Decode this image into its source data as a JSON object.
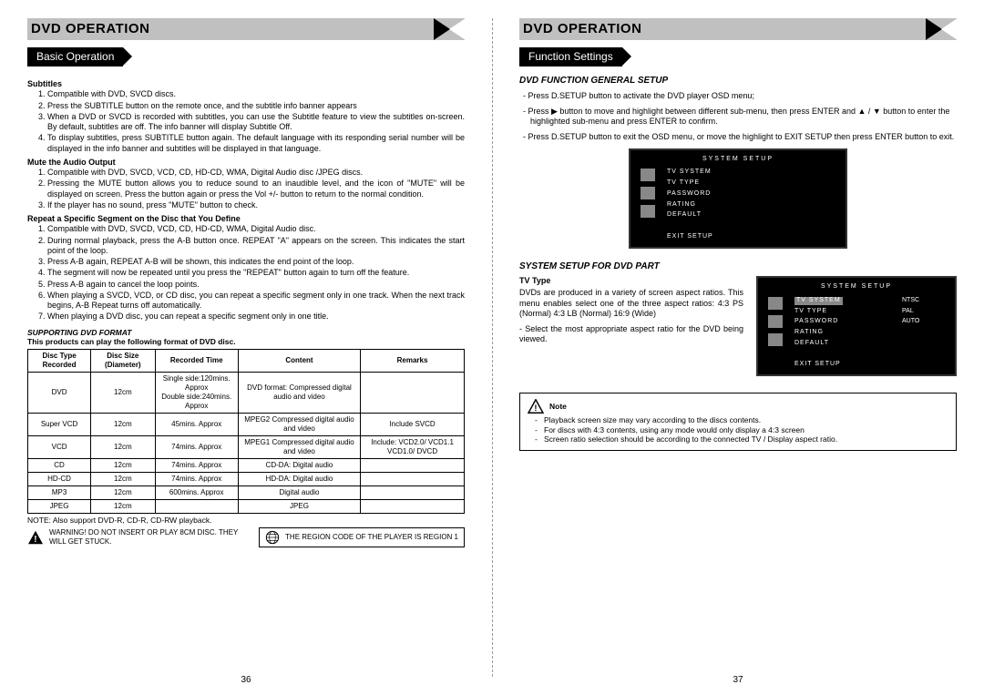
{
  "left": {
    "header": "DVD OPERATION",
    "sub": "Basic Operation",
    "s1": {
      "title": "Subtitles",
      "items": [
        "Compatible with DVD, SVCD discs.",
        "Press the SUBTITLE button on the remote once, and the subtitle info banner appears",
        "When a DVD or SVCD is recorded with subtitles, you can use the Subtitle feature to view the subtitles on-screen. By default, subtitles are off. The info banner will display Subtitle Off.",
        "To display subtitles, press SUBTITLE button again. The default language with its responding serial number will be displayed in the info banner and subtitles will be displayed in that language."
      ]
    },
    "s2": {
      "title": "Mute the Audio Output",
      "items": [
        "Compatible with DVD, SVCD, VCD, CD, HD-CD, WMA, Digital Audio disc /JPEG discs.",
        "Pressing the MUTE button allows you to reduce sound to an inaudible level, and the icon of \"MUTE\" will be displayed on screen. Press the button again or press the Vol +/- button to return to the normal condition.",
        "If the player has no sound, press \"MUTE\" button to check."
      ]
    },
    "s3": {
      "title": "Repeat a Specific Segment on the Disc that You Define",
      "items": [
        "Compatible with DVD, SVCD, VCD, CD, HD-CD, WMA, Digital Audio disc.",
        "During normal playback, press the A-B button once. REPEAT \"A\" appears on the screen. This indicates the start point of the loop.",
        "Press A-B again, REPEAT A-B will be shown, this indicates the end point of the loop.",
        "The segment will now be repeated until you press the \"REPEAT\" button again to turn off the feature.",
        "Press A-B again to cancel the loop points.",
        "When playing a SVCD, VCD, or CD disc, you can repeat a specific segment only in one track. When the next track begins, A-B Repeat turns off automatically.",
        "When playing a DVD disc, you can repeat a specific segment only in one title."
      ]
    },
    "fmt_title": "SUPPORTING DVD FORMAT",
    "fmt_sub": "This products can play the following format of DVD disc.",
    "th": [
      "Disc Type Recorded",
      "Disc Size (Diameter)",
      "Recorded Time",
      "Content",
      "Remarks"
    ],
    "rows": [
      [
        "DVD",
        "12cm",
        "Single side:120mins. Approx\nDouble side:240mins. Approx",
        "DVD format: Compressed digital audio and video",
        ""
      ],
      [
        "Super VCD",
        "12cm",
        "45mins. Approx",
        "MPEG2 Compressed digital audio and video",
        "Include SVCD"
      ],
      [
        "VCD",
        "12cm",
        "74mins. Approx",
        "MPEG1 Compressed digital audio and video",
        "Include: VCD2.0/ VCD1.1 VCD1.0/ DVCD"
      ],
      [
        "CD",
        "12cm",
        "74mins. Approx",
        "CD-DA: Digital audio",
        ""
      ],
      [
        "HD-CD",
        "12cm",
        "74mins. Approx",
        "HD-DA: Digital audio",
        ""
      ],
      [
        "MP3",
        "12cm",
        "600mins. Approx",
        "Digital audio",
        ""
      ],
      [
        "JPEG",
        "12cm",
        "",
        "JPEG",
        ""
      ]
    ],
    "note": "NOTE: Also support DVD-R, CD-R, CD-RW playback.",
    "warn": "WARNING! DO NOT INSERT OR PLAY 8CM DISC. THEY WILL GET STUCK.",
    "region": "THE REGION CODE OF THE PLAYER IS REGION 1",
    "pnum": "36"
  },
  "right": {
    "header": "DVD OPERATION",
    "sub": "Function Settings",
    "gs": {
      "title": "DVD FUNCTION GENERAL SETUP",
      "b1": "- Press D.SETUP button to activate the DVD player OSD menu;",
      "b2": "- Press ▶ button to move and highlight between different sub-menu, then press ENTER and ▲ / ▼ button to enter the highlighted sub-menu and press ENTER to confirm.",
      "b3": "- Press D.SETUP button to exit the OSD menu, or move the highlight to EXIT SETUP then press ENTER button to exit."
    },
    "osd1": {
      "title": "SYSTEM  SETUP",
      "items": [
        "TV SYSTEM",
        "TV TYPE",
        "PASSWORD",
        "RATING",
        "DEFAULT",
        "",
        "EXIT SETUP"
      ]
    },
    "ss": {
      "title": "SYSTEM SETUP FOR DVD PART",
      "tvtype": "TV Type",
      "p1": "DVDs are produced in a variety of screen aspect ratios. This menu enables select one of the three aspect ratios: 4:3 PS (Normal)    4:3 LB (Normal) 16:9 (Wide)",
      "p2": "- Select the most appropriate aspect ratio for the DVD being viewed."
    },
    "osd2": {
      "title": "SYSTEM  SETUP",
      "menu": [
        "TV SYSTEM",
        "TV TYPE",
        "PASSWORD",
        "RATING",
        "DEFAULT",
        "",
        "EXIT SETUP"
      ],
      "opts": [
        "NTSC",
        "PAL",
        "AUTO"
      ]
    },
    "notebox": {
      "head": "Note",
      "n1": "Playback screen size may vary according to the discs contents.",
      "n2": "For discs with 4:3 contents, using any mode would only display a 4:3 screen",
      "n3": "Screen ratio selection should be according to the connected TV / Display   aspect ratio."
    },
    "pnum": "37"
  }
}
